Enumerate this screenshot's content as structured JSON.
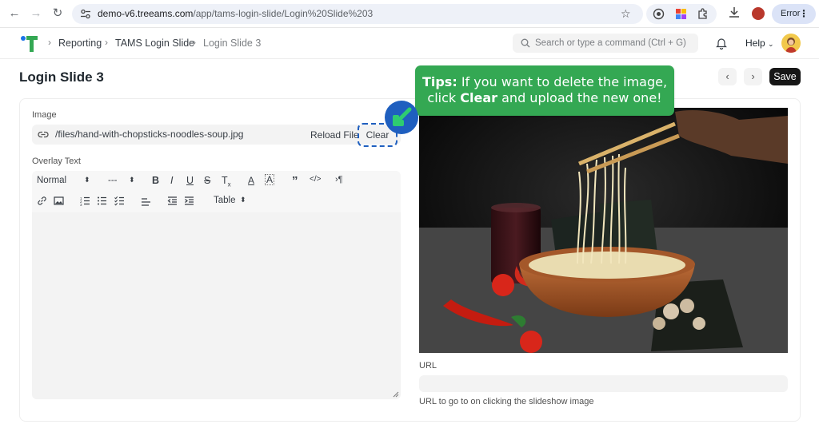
{
  "browser": {
    "url_host": "demo-v6.treeams.com",
    "url_path": "/app/tams-login-slide/Login%20Slide%203",
    "error_label": "Error"
  },
  "header": {
    "breadcrumbs": [
      "Reporting",
      "TAMS Login Slide",
      "Login Slide 3"
    ],
    "search_placeholder": "Search or type a command (Ctrl + G)",
    "help_label": "Help"
  },
  "page": {
    "title": "Login Slide 3",
    "prev_label": "‹",
    "next_label": "›",
    "save_label": "Save"
  },
  "form": {
    "image_label": "Image",
    "image_path": "/files/hand-with-chopsticks-noodles-soup.jpg",
    "reload_label": "Reload File",
    "clear_label": "Clear",
    "overlay_label": "Overlay Text",
    "toolbar": {
      "format_select": "Normal",
      "size_select": "---",
      "table_select": "Table"
    },
    "url_label": "URL",
    "url_value": "",
    "url_help": "URL to go to on clicking the slideshow image"
  },
  "tip": {
    "prefix": "Tips:",
    "line1": " If you want to delete the image,",
    "line2a": "click ",
    "line2b": "Clear",
    "line2c": " and upload the new one!"
  },
  "colors": {
    "accent": "#1f5fbf",
    "tip_green": "#34a853",
    "save_bg": "#171717"
  }
}
